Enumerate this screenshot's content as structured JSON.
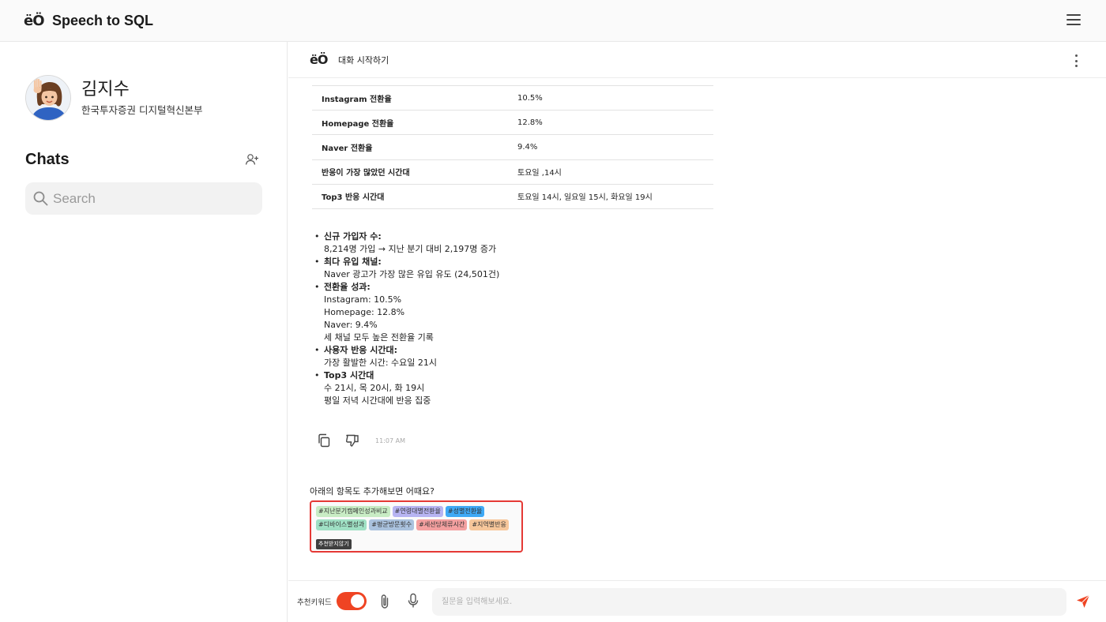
{
  "header": {
    "logo": "ëÖ",
    "title": "Speech to SQL",
    "menu_icon": "hamburger-icon"
  },
  "sidebar": {
    "profile": {
      "name": "김지수",
      "dept": "한국투자증권 디지털혁신본부"
    },
    "chats_title": "Chats",
    "search_placeholder": "Search"
  },
  "chat": {
    "logo": "ëÖ",
    "title": "대화 시작하기",
    "table": [
      {
        "key": "Instagram 전환율",
        "value": "10.5%"
      },
      {
        "key": "Homepage 전환율",
        "value": "12.8%"
      },
      {
        "key": "Naver 전환율",
        "value": "9.4%"
      },
      {
        "key": "반응이 가장 많았던 시간대",
        "value": "토요일 ,14시"
      },
      {
        "key": "Top3 반응 시간대",
        "value": "토요일 14시, 일요일 15시, 화요일 19시"
      }
    ],
    "summary": [
      {
        "heading": "신규 가입자 수:",
        "lines": [
          "8,214명 가입 → 지난 분기 대비 2,197명 증가"
        ]
      },
      {
        "heading": "최다 유입 채널:",
        "lines": [
          "Naver 광고가 가장 많은 유입 유도 (24,501건)"
        ]
      },
      {
        "heading": "전환율 성과:",
        "lines": [
          "Instagram: 10.5%",
          "Homepage: 12.8%",
          "Naver: 9.4%",
          "세 채널 모두 높은 전환율 기록"
        ]
      },
      {
        "heading": "사용자 반응 시간대:",
        "lines": [
          "가장 활발한 시간: 수요일 21시"
        ]
      },
      {
        "heading": "Top3 시간대",
        "lines": [
          "수 21시, 목 20시, 화 19시",
          "평일 저녁 시간대에 반응 집중"
        ]
      }
    ],
    "timestamp": "11:07 AM",
    "suggest_question": "아래의 항목도 추가해보면 어때요?",
    "tags_row1": [
      {
        "label": "#지난분기캠페인성과비교",
        "color": "#c8ecc4"
      },
      {
        "label": "#연령대별전환율",
        "color": "#b7b4f2"
      },
      {
        "label": "#성별전환율",
        "color": "#3fa9f5"
      }
    ],
    "tags_row2": [
      {
        "label": "#디바이스별성과",
        "color": "#9fe0c4"
      },
      {
        "label": "#평균방문횟수",
        "color": "#aac2de"
      },
      {
        "label": "#세션당체류시간",
        "color": "#f4a0a0"
      },
      {
        "label": "#지역별반응",
        "color": "#f7c79b"
      }
    ],
    "no_recommend": "추천받지않기"
  },
  "inputbar": {
    "keyword_label": "추천키워드",
    "toggle_on": true,
    "placeholder": "질문을 입력해보세요.",
    "accent": "#ef4423"
  }
}
